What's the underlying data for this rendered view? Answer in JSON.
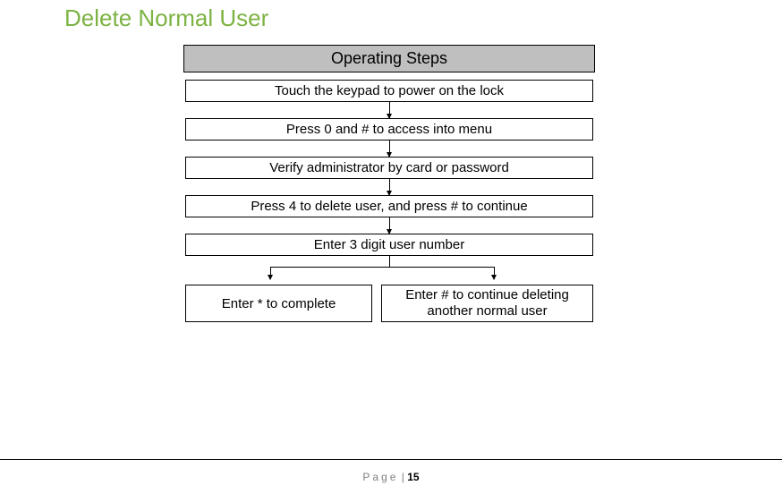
{
  "title": "Delete Normal User",
  "header": "Operating Steps",
  "steps": {
    "s1": "Touch the keypad to power on the lock",
    "s2": "Press 0 and # to access into menu",
    "s3": "Verify administrator by card or password",
    "s4": "Press 4 to delete user, and press # to continue",
    "s5": "Enter 3 digit user number"
  },
  "branches": {
    "left": "Enter * to complete",
    "right": "Enter # to continue deleting another normal user"
  },
  "footer": {
    "label": "Page",
    "sep": "|",
    "num": "15"
  }
}
